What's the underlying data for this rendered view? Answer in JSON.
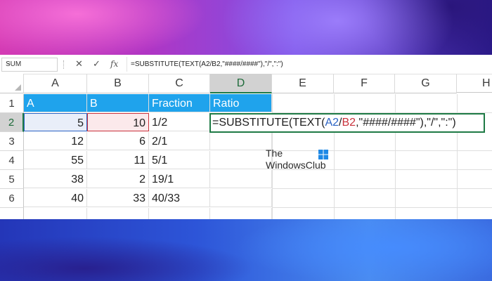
{
  "formula_bar": {
    "name_box": "SUM",
    "name_box_dropdown": "⌄",
    "cancel_icon": "✕",
    "enter_icon": "✓",
    "function_icon": "fx",
    "formula": "=SUBSTITUTE(TEXT(A2/B2,\"####/####\"),\"/\",\":\")"
  },
  "columns": [
    "A",
    "B",
    "C",
    "D",
    "E",
    "F",
    "G",
    "H"
  ],
  "active_column": "D",
  "rows": [
    "1",
    "2",
    "3",
    "4",
    "5",
    "6"
  ],
  "active_row": "2",
  "sheet": {
    "headers": {
      "a": "A",
      "b": "B",
      "c": "Fraction",
      "d": "Ratio"
    },
    "data": [
      {
        "a": "5",
        "b": "10",
        "c": "1/2"
      },
      {
        "a": "12",
        "b": "6",
        "c": "2/1"
      },
      {
        "a": "55",
        "b": "11",
        "c": "5/1"
      },
      {
        "a": "38",
        "b": "2",
        "c": "19/1"
      },
      {
        "a": "40",
        "b": "33",
        "c": "40/33"
      }
    ]
  },
  "editing_cell": {
    "p1": "=SUBSTITUTE(TEXT(",
    "ref1": "A2",
    "p2": "/",
    "ref2": "B2",
    "p3": ",\"####/####\"),\"/\",\":\")"
  },
  "watermark": {
    "line1": "The",
    "line2": "WindowsClub"
  },
  "colors": {
    "header_fill": "#1fa3ec",
    "selection_green": "#1e7a45",
    "ref_blue": "#2b63c4",
    "ref_red": "#c9323c"
  }
}
